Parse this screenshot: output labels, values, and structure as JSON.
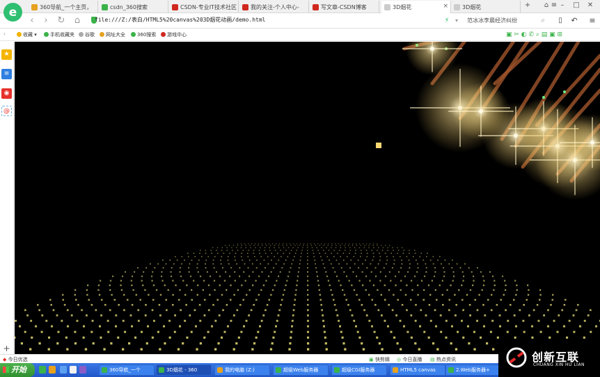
{
  "browser": {
    "tabs": [
      {
        "label": "360导航_一个主页，",
        "color": "#e6a11e"
      },
      {
        "label": "csdn_360搜索",
        "color": "#3bb34a"
      },
      {
        "label": "CSDN-专业IT技术社区",
        "color": "#d0281f"
      },
      {
        "label": "我的关注-个人中心-",
        "color": "#d0281f"
      },
      {
        "label": "写文章-CSDN博客",
        "color": "#d0281f"
      },
      {
        "label": "3D烟花",
        "color": "#cccccc",
        "active": true
      },
      {
        "label": "3D烟花",
        "color": "#cccccc"
      }
    ],
    "url": "file:///Z:/表白/HTML5%20canvas%203D烟花动画/demo.html",
    "search_text": "范冰冰李晨经济纠纷",
    "bookmarks": [
      "收藏",
      "手机收藏夹",
      "谷歌",
      "网址大全",
      "360搜索",
      "游戏中心"
    ],
    "status": {
      "left": "今日优选",
      "items": [
        "快剪辑",
        "今日直播",
        "热点资讯"
      ]
    }
  },
  "taskbar": {
    "start": "开始",
    "tasks": [
      {
        "label": "360导航_一个",
        "active": false
      },
      {
        "label": "3D烟花 - 360",
        "active": true
      },
      {
        "label": "我的电脑 (Z:)",
        "active": false
      },
      {
        "label": "超级Web服务器",
        "active": false
      },
      {
        "label": "超级CGI服务器",
        "active": false
      },
      {
        "label": "HTML5 canvas",
        "active": false
      },
      {
        "label": "2.Web服务器+",
        "active": false
      }
    ]
  },
  "watermark": {
    "brand_cn": "创新互联",
    "brand_en": "CHUANG XIN HU LIAN"
  },
  "colors": {
    "accent_green": "#2fbf71",
    "taskbar_blue": "#2a64c8",
    "canvas_bg": "#000000",
    "spark": "#f8d870",
    "grid_dot": "#d8d070"
  }
}
